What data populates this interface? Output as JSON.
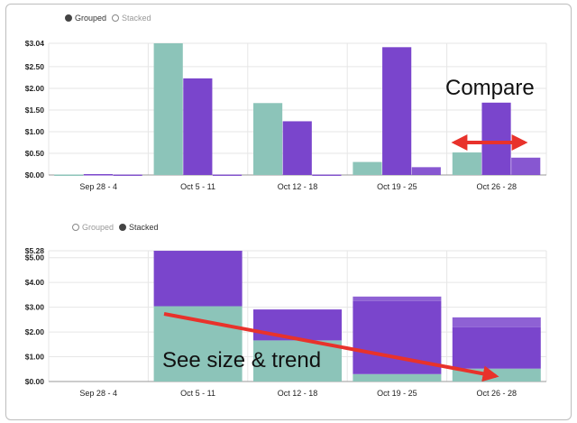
{
  "colors": {
    "teal": "#8cc4b9",
    "purple": "#7a45cc",
    "purple_dark": "#6b3bb5",
    "red": "#e8322b",
    "grid": "#e6e6e6"
  },
  "top_chart": {
    "legend": {
      "grouped": "Grouped",
      "stacked": "Stacked",
      "selected": "grouped"
    }
  },
  "bottom_chart": {
    "legend": {
      "grouped": "Grouped",
      "stacked": "Stacked",
      "selected": "stacked"
    }
  },
  "annotations": {
    "compare": "Compare",
    "trend": "See size & trend"
  },
  "chart_data": [
    {
      "type": "bar",
      "mode": "grouped",
      "categories": [
        "Sep 28 - 4",
        "Oct 5 - 11",
        "Oct 12 - 18",
        "Oct 19 - 25",
        "Oct 26 - 28"
      ],
      "series": [
        {
          "color": "#8cc4b9",
          "values": [
            0.01,
            3.04,
            1.66,
            0.3,
            0.52
          ]
        },
        {
          "color": "#7a45cc",
          "values": [
            0.02,
            2.23,
            1.24,
            2.95,
            1.67
          ]
        },
        {
          "color": "#7a45cc",
          "values": [
            0.01,
            0.01,
            0.01,
            0.18,
            0.4
          ]
        }
      ],
      "yticks": [
        "$0.00",
        "$0.50",
        "$1.00",
        "$1.50",
        "$2.00",
        "$2.50",
        "$3.04"
      ],
      "ytick_values": [
        0,
        0.5,
        1.0,
        1.5,
        2.0,
        2.5,
        3.04
      ],
      "ylim": [
        0,
        3.04
      ],
      "grid": true
    },
    {
      "type": "bar",
      "mode": "stacked",
      "categories": [
        "Sep 28 - 4",
        "Oct 5 - 11",
        "Oct 12 - 18",
        "Oct 19 - 25",
        "Oct 26 - 28"
      ],
      "series": [
        {
          "color": "#8cc4b9",
          "values": [
            0.0,
            3.04,
            1.66,
            0.3,
            0.52
          ]
        },
        {
          "color": "#7a45cc",
          "values": [
            0.0,
            2.23,
            1.24,
            2.95,
            1.67
          ]
        },
        {
          "color": "#7a45cc",
          "values": [
            0.0,
            0.01,
            0.01,
            0.18,
            0.4
          ]
        }
      ],
      "yticks": [
        "$0.00",
        "$1.00",
        "$2.00",
        "$3.00",
        "$4.00",
        "$5.00",
        "$5.28"
      ],
      "ytick_values": [
        0,
        1,
        2,
        3,
        4,
        5,
        5.28
      ],
      "ylim": [
        0,
        5.28
      ],
      "grid": true
    }
  ]
}
